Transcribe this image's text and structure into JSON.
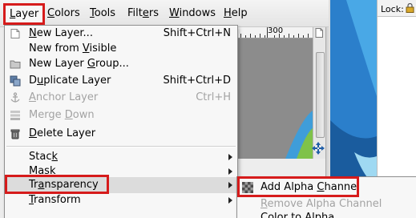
{
  "menubar": {
    "items": [
      {
        "label_pre": "",
        "mnemonic": "L",
        "label_post": "ayer"
      },
      {
        "label_pre": "",
        "mnemonic": "C",
        "label_post": "olors"
      },
      {
        "label_pre": "",
        "mnemonic": "T",
        "label_post": "ools"
      },
      {
        "label_pre": "Filt",
        "mnemonic": "e",
        "label_post": "rs"
      },
      {
        "label_pre": "",
        "mnemonic": "W",
        "label_post": "indows"
      },
      {
        "label_pre": "",
        "mnemonic": "H",
        "label_post": "elp"
      }
    ]
  },
  "ruler": {
    "label": "300"
  },
  "layers_panel": {
    "lock_label": "Lock:"
  },
  "layer_menu": {
    "items": [
      {
        "pre": "",
        "mn": "N",
        "post": "ew Layer...",
        "shortcut": "Shift+Ctrl+N",
        "icon": "new-layer-icon",
        "enabled": true
      },
      {
        "pre": "New from ",
        "mn": "V",
        "post": "isible",
        "shortcut": "",
        "icon": "",
        "enabled": true
      },
      {
        "pre": "New Layer ",
        "mn": "G",
        "post": "roup...",
        "shortcut": "",
        "icon": "folder-icon",
        "enabled": true
      },
      {
        "pre": "D",
        "mn": "u",
        "post": "plicate Layer",
        "shortcut": "Shift+Ctrl+D",
        "icon": "duplicate-icon",
        "enabled": true
      },
      {
        "pre": "",
        "mn": "A",
        "post": "nchor Layer",
        "shortcut": "Ctrl+H",
        "icon": "anchor-icon",
        "enabled": false
      },
      {
        "pre": "Merge ",
        "mn": "D",
        "post": "own",
        "shortcut": "",
        "icon": "merge-down-icon",
        "enabled": false
      },
      {
        "pre": "",
        "mn": "D",
        "post": "elete Layer",
        "shortcut": "",
        "icon": "trash-icon",
        "enabled": true
      },
      {
        "pre": "Stac",
        "mn": "k",
        "post": "",
        "shortcut": "",
        "icon": "",
        "enabled": true,
        "submenu": true
      },
      {
        "pre": "",
        "mn": "M",
        "post": "ask",
        "shortcut": "",
        "icon": "",
        "enabled": true,
        "submenu": true
      },
      {
        "pre": "Tr",
        "mn": "a",
        "post": "nsparency",
        "shortcut": "",
        "icon": "",
        "enabled": true,
        "submenu": true
      },
      {
        "pre": "",
        "mn": "T",
        "post": "ransform",
        "shortcut": "",
        "icon": "",
        "enabled": true,
        "submenu": true
      }
    ]
  },
  "transparency_submenu": {
    "items": [
      {
        "pre": "Add Alpha ",
        "mn": "C",
        "post": "hannel",
        "icon": "checkerboard-icon",
        "enabled": true
      },
      {
        "pre": "",
        "mn": "R",
        "post": "emove Alpha Channel",
        "icon": "",
        "enabled": false
      },
      {
        "pre": "Color to Alpha...",
        "mn": "",
        "post": "",
        "icon": "",
        "enabled": true
      }
    ]
  },
  "colors": {
    "highlight_red": "#d61b1b",
    "menu_bg": "#f7f7f7",
    "desktop_blue": "#2a7cc9"
  }
}
